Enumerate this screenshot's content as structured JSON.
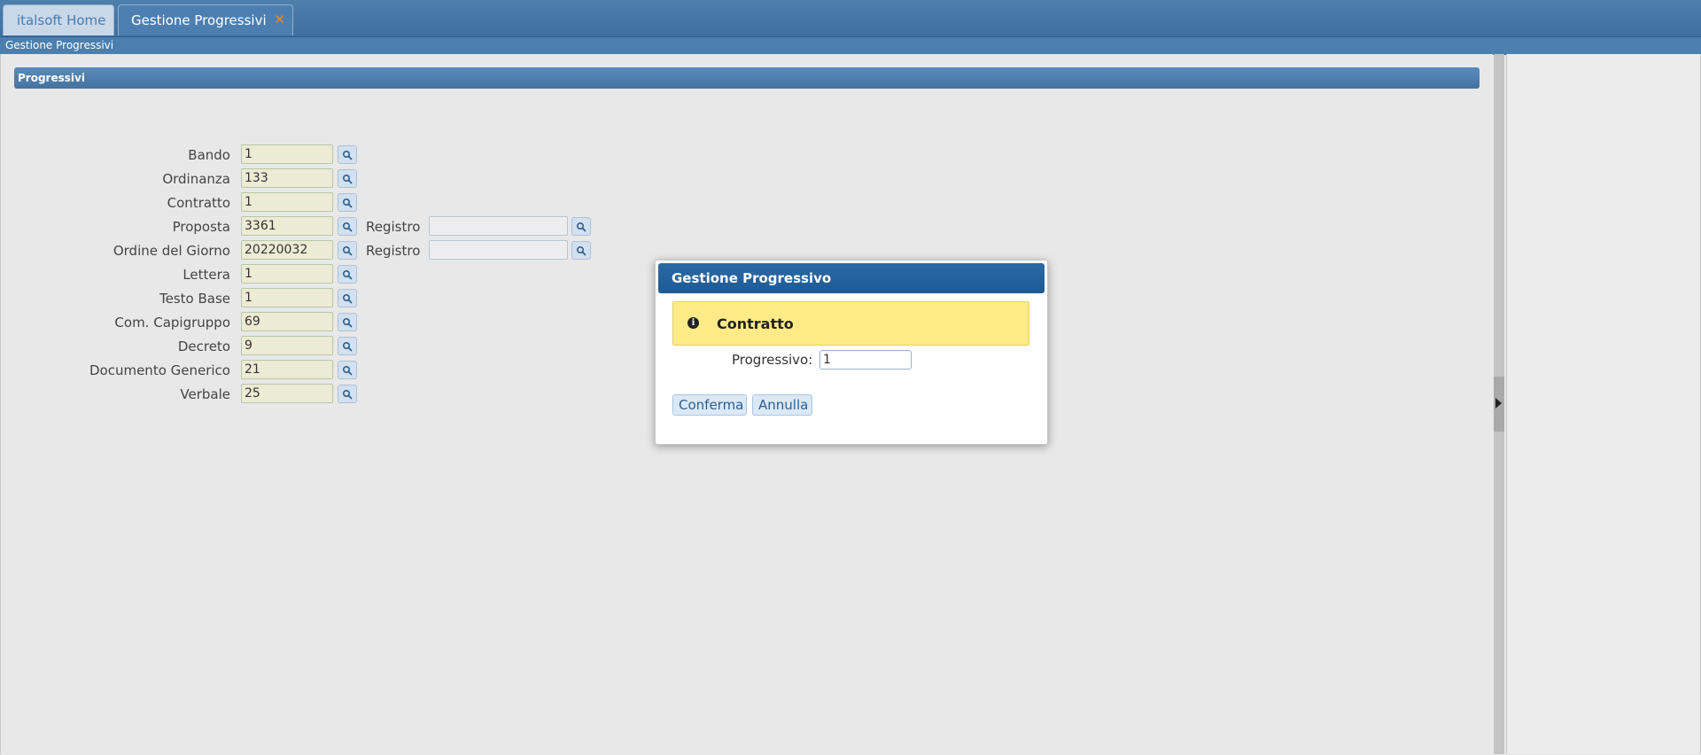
{
  "tabs": [
    {
      "label": "italsoft Home",
      "active": false
    },
    {
      "label": "Gestione Progressivi",
      "active": true,
      "close_glyph": "✕"
    }
  ],
  "breadcrumb": "Gestione Progressivi",
  "section": {
    "title": "Progressivi"
  },
  "fields": [
    {
      "label": "Bando",
      "value": "1"
    },
    {
      "label": "Ordinanza",
      "value": "133"
    },
    {
      "label": "Contratto",
      "value": "1"
    },
    {
      "label": "Proposta",
      "value": "3361",
      "extra_label": "Registro",
      "extra_value": ""
    },
    {
      "label": "Ordine del Giorno",
      "value": "20220032",
      "extra_label": "Registro",
      "extra_value": ""
    },
    {
      "label": "Lettera",
      "value": "1"
    },
    {
      "label": "Testo Base",
      "value": "1"
    },
    {
      "label": "Com. Capigruppo",
      "value": "69"
    },
    {
      "label": "Decreto",
      "value": "9"
    },
    {
      "label": "Documento Generico",
      "value": "21"
    },
    {
      "label": "Verbale",
      "value": "25"
    }
  ],
  "dialog": {
    "title": "Gestione Progressivo",
    "info_title": "Contratto",
    "info_icon_glyph": "i",
    "progressivo_label": "Progressivo:",
    "progressivo_value": "1",
    "confirm_label": "Conferma",
    "cancel_label": "Annulla"
  },
  "icons": {
    "lookup": "search-icon",
    "info": "info-icon",
    "splitter": "arrow-right-icon",
    "close": "close-icon"
  },
  "colors": {
    "tab_bar": "#4f7fad",
    "dialog_header": "#2b6aa6",
    "info_box": "#ffeb87",
    "input_fill": "#ecebd4",
    "close_accent": "#f08a1f"
  }
}
